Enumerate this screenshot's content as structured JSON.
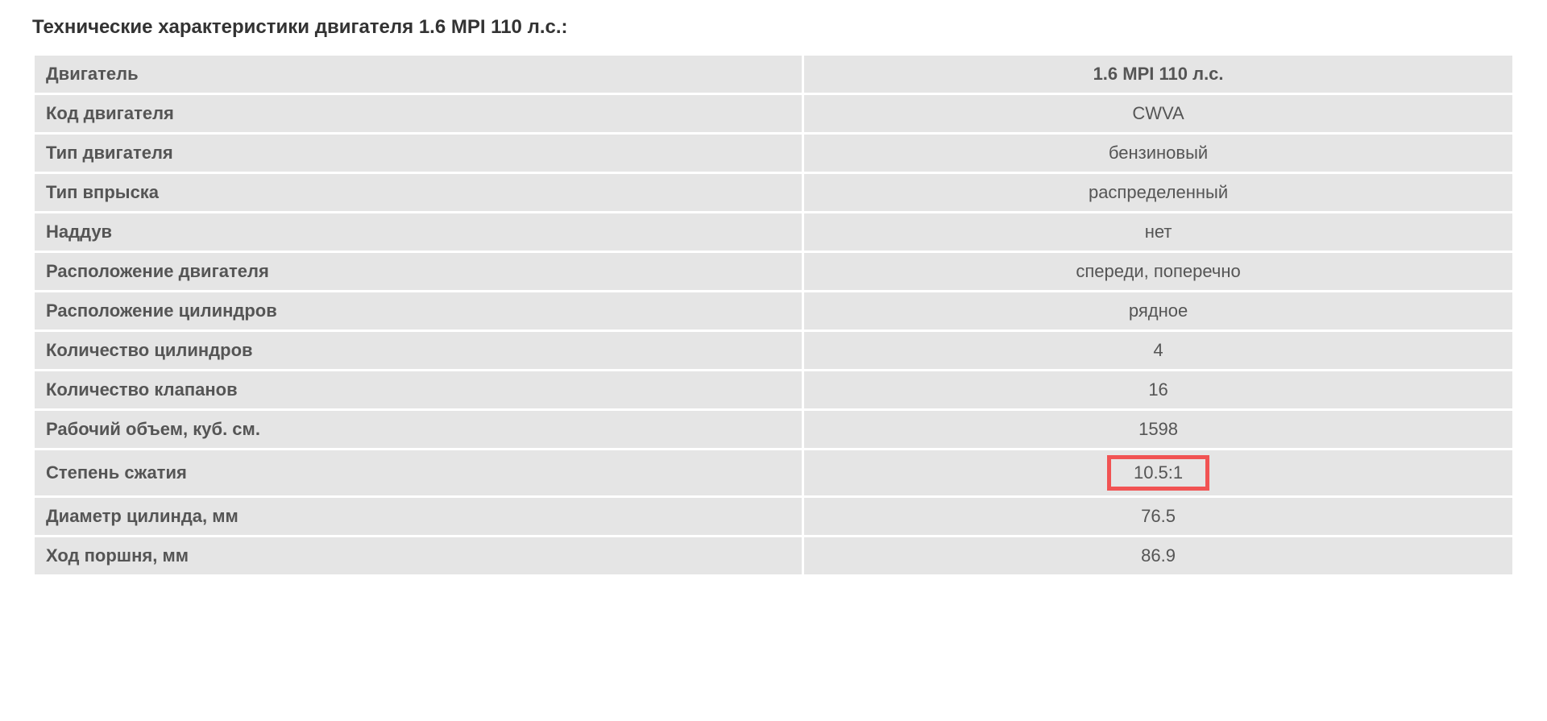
{
  "title": "Технические характеристики двигателя 1.6 MPI 110 л.с.:",
  "rows": [
    {
      "label": "Двигатель",
      "value": "1.6 MPI 110 л.с.",
      "header": true
    },
    {
      "label": "Код двигателя",
      "value": "CWVA"
    },
    {
      "label": "Тип двигателя",
      "value": "бензиновый"
    },
    {
      "label": "Тип впрыска",
      "value": "распределенный"
    },
    {
      "label": "Наддув",
      "value": "нет"
    },
    {
      "label": "Расположение двигателя",
      "value": "спереди, поперечно"
    },
    {
      "label": "Расположение цилиндров",
      "value": "рядное"
    },
    {
      "label": "Количество цилиндров",
      "value": "4"
    },
    {
      "label": "Количество клапанов",
      "value": "16"
    },
    {
      "label": "Рабочий объем, куб. см.",
      "value": "1598"
    },
    {
      "label": "Степень сжатия",
      "value": "10.5:1",
      "highlighted": true
    },
    {
      "label": "Диаметр цилинда, мм",
      "value": "76.5"
    },
    {
      "label": "Ход поршня, мм",
      "value": "86.9"
    }
  ]
}
